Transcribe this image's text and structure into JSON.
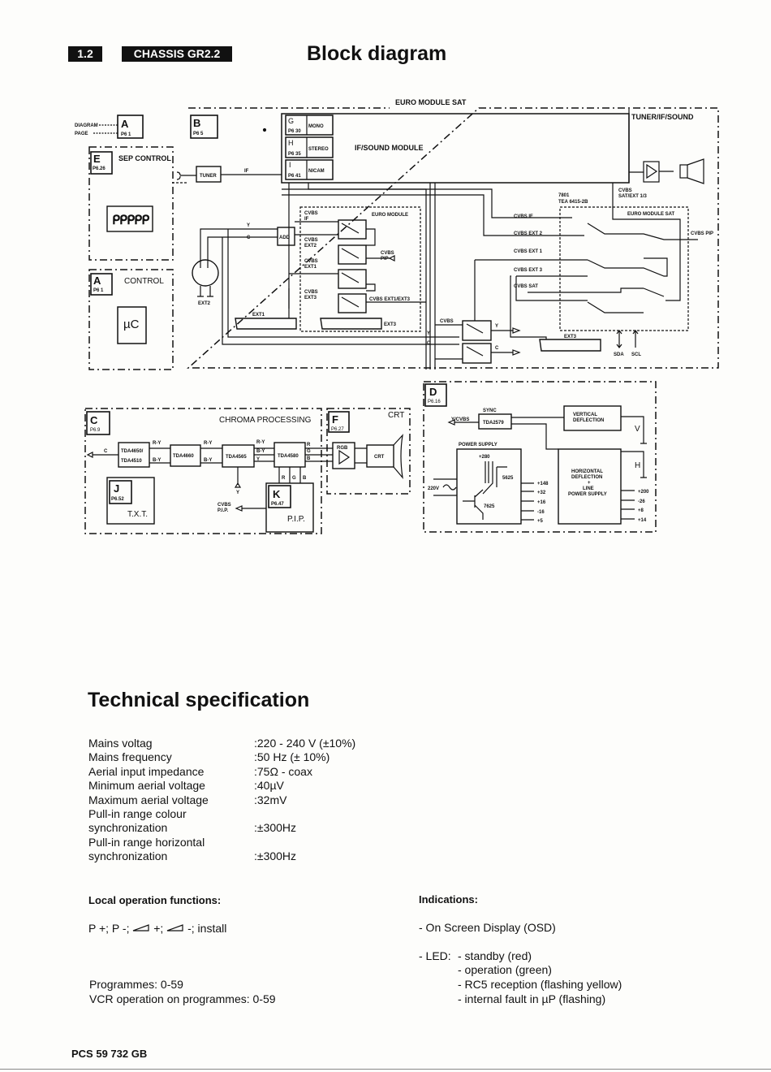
{
  "header": {
    "section": "1.2",
    "chassis": "CHASSIS GR2.2",
    "title": "Block diagram"
  },
  "diagram": {
    "legend": {
      "diagram": "DIAGRAM",
      "page": "PAGE",
      "letter": "A",
      "ref": "P6 1"
    },
    "euro_module_sat_title": "EURO MODULE SAT",
    "tuner_if_sound": "TUNER/IF/SOUND",
    "block_b": {
      "letter": "B",
      "ref": "P6 5"
    },
    "block_e": {
      "letter": "E",
      "ref": "P6.26",
      "label": "SEP CONTROL"
    },
    "block_a": {
      "letter": "A",
      "ref": "P6 1",
      "label": "CONTROL",
      "uc": "µC"
    },
    "if_sound_module": "IF/SOUND MODULE",
    "sub_modules": [
      {
        "letter": "G",
        "ref": "P6 30",
        "label": "MONO"
      },
      {
        "letter": "H",
        "ref": "P6 35",
        "label": "STEREO"
      },
      {
        "letter": "I",
        "ref": "P6 41",
        "label": "NICAM"
      }
    ],
    "tuner": "TUNER",
    "if": "IF",
    "y": "Y",
    "c": "C",
    "add": "ADD",
    "ext1": "EXT1",
    "ext2": "EXT2",
    "ext3": "EXT3",
    "euro_module": "EURO MODULE",
    "euro_inputs": [
      "CVBS",
      "IF",
      "CVBS",
      "EXT2",
      "CVBS",
      "EXT1",
      "CVBS",
      "EXT3"
    ],
    "cvbs_pip": [
      "CVBS",
      "PIP"
    ],
    "cvbs_ext1_ext3": "CVBS EXT1/EXT3",
    "cvbs": "CVBS",
    "cvbs_sat_ext": [
      "CVBS",
      "SAT/EXT 1/3"
    ],
    "ic": [
      "7801",
      "TEA 6415-2B"
    ],
    "euro_module_sat": "EURO MODULE SAT",
    "sat_inputs": [
      "CVBS IF",
      "CVBS EXT 2",
      "CVBS EXT 1",
      "CVBS EXT 3",
      "CVBS SAT"
    ],
    "cvbs_pip_out": "CVBS PIP",
    "sda": "SDA",
    "scl": "SCL",
    "block_c": {
      "letter": "C",
      "ref": "P6.9",
      "label": "CHROMA PROCESSING"
    },
    "chroma_ics": [
      "TDA4650/",
      "TDA4510",
      "TDA4660",
      "TDA4565",
      "TDA4580"
    ],
    "ry": "R-Y",
    "by": "B-Y",
    "r": "R",
    "g": "G",
    "b": "B",
    "block_j": {
      "letter": "J",
      "ref": "P6.52",
      "label": "T.X.T."
    },
    "block_k": {
      "letter": "K",
      "ref": "P6.47",
      "label": "P.I.P."
    },
    "cvbs_pip_in": [
      "CVBS",
      "P.I.P."
    ],
    "block_f": {
      "letter": "F",
      "ref": "P6.27",
      "label": "CRT"
    },
    "rgb": "RGB",
    "crt": "CRT",
    "block_d": {
      "letter": "D",
      "ref": "P6.16"
    },
    "sync": "SYNC",
    "y_cvbs": "Y/CVBS",
    "tda2579": "TDA2579",
    "vertical": [
      "VERTICAL",
      "DEFLECTION"
    ],
    "v": "V",
    "h": "H",
    "power_supply": "POWER SUPPLY",
    "v280": "+280",
    "t5625": "5625",
    "t7625": "7625",
    "v220": "220V",
    "ps_outputs": [
      "+148",
      "+32",
      "+16",
      "-16",
      "+5"
    ],
    "horizontal": [
      "HORIZONTAL",
      "DEFLECTION",
      "+",
      "LINE",
      "POWER SUPPLY"
    ],
    "hd_outputs": [
      "+200",
      "-26",
      "+8",
      "+14"
    ]
  },
  "spec": {
    "title": "Technical specification",
    "rows": [
      {
        "label": "Mains voltag",
        "value": ":220 - 240 V (±10%)"
      },
      {
        "label": "Mains frequency",
        "value": ":50 Hz (± 10%)"
      },
      {
        "label": "Aerial input impedance",
        "value": ":75Ω - coax"
      },
      {
        "label": "Minimum aerial voltage",
        "value": ":40µV"
      },
      {
        "label": "Maximum aerial voltage",
        "value": ":32mV"
      },
      {
        "label": "Pull-in range colour",
        "value": ""
      },
      {
        "label": "synchronization",
        "value": ":±300Hz"
      },
      {
        "label": "Pull-in range horizontal",
        "value": ""
      },
      {
        "label": "synchronization",
        "value": ":±300Hz"
      }
    ]
  },
  "local": {
    "title": "Local operation functions:",
    "functions": [
      "P +; P -; ",
      " +; ",
      " -; install"
    ],
    "programmes": "Programmes: 0-59",
    "vcr": "VCR operation on programmes: 0-59"
  },
  "indications": {
    "title": "Indications:",
    "osd": "- On Screen Display (OSD)",
    "led": "- LED:",
    "led_items": [
      "- standby (red)",
      "- operation (green)",
      "- RC5 reception (flashing yellow)",
      "- internal fault in µP (flashing)"
    ]
  },
  "footer": "PCS 59 732  GB"
}
